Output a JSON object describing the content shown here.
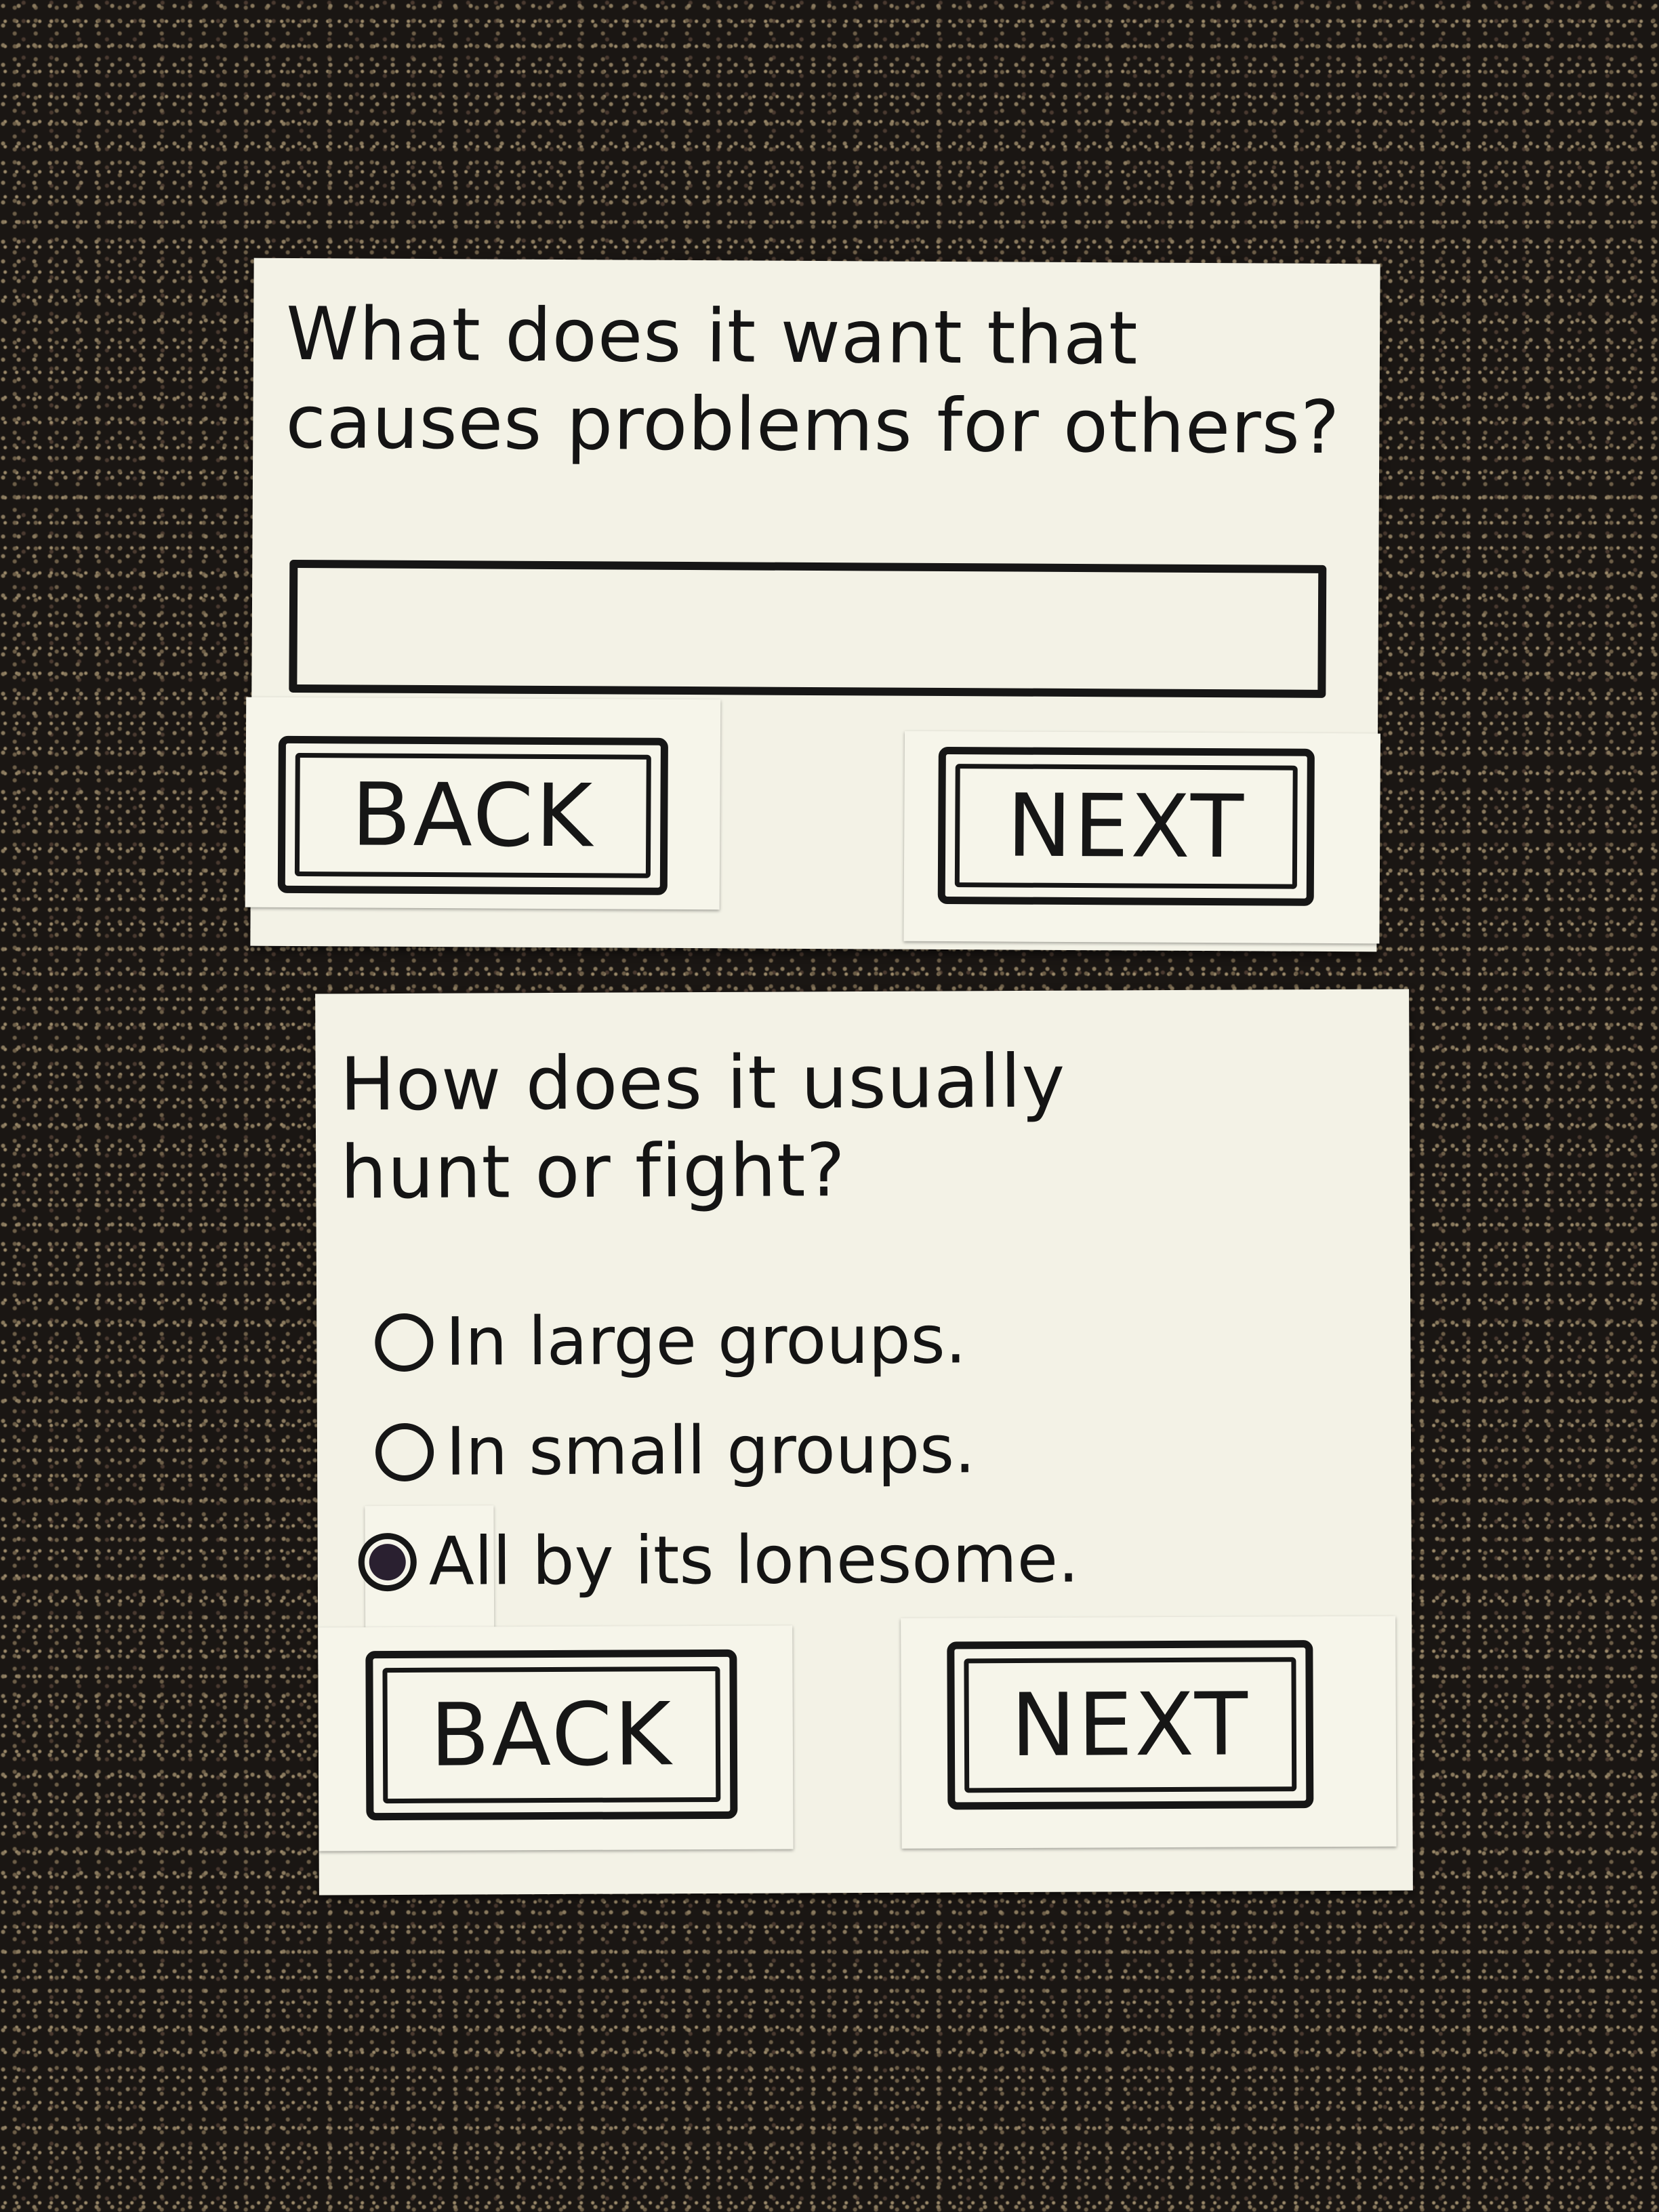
{
  "screens": [
    {
      "question_lines": [
        "What does it want that",
        "causes problems for others?"
      ],
      "answer_value": "",
      "back_label": "BACK",
      "next_label": "NEXT"
    },
    {
      "question_lines": [
        "How does it usually",
        "hunt or fight?"
      ],
      "options": [
        {
          "label": "In large groups.",
          "selected": false
        },
        {
          "label": "In small groups.",
          "selected": false
        },
        {
          "label": "All by its lonesome.",
          "selected": true
        }
      ],
      "back_label": "BACK",
      "next_label": "NEXT"
    }
  ],
  "colors": {
    "paper": "#f3f2e6",
    "ink": "#161616",
    "carpet": "#1a1613",
    "selected_radio": "#2a2030"
  }
}
